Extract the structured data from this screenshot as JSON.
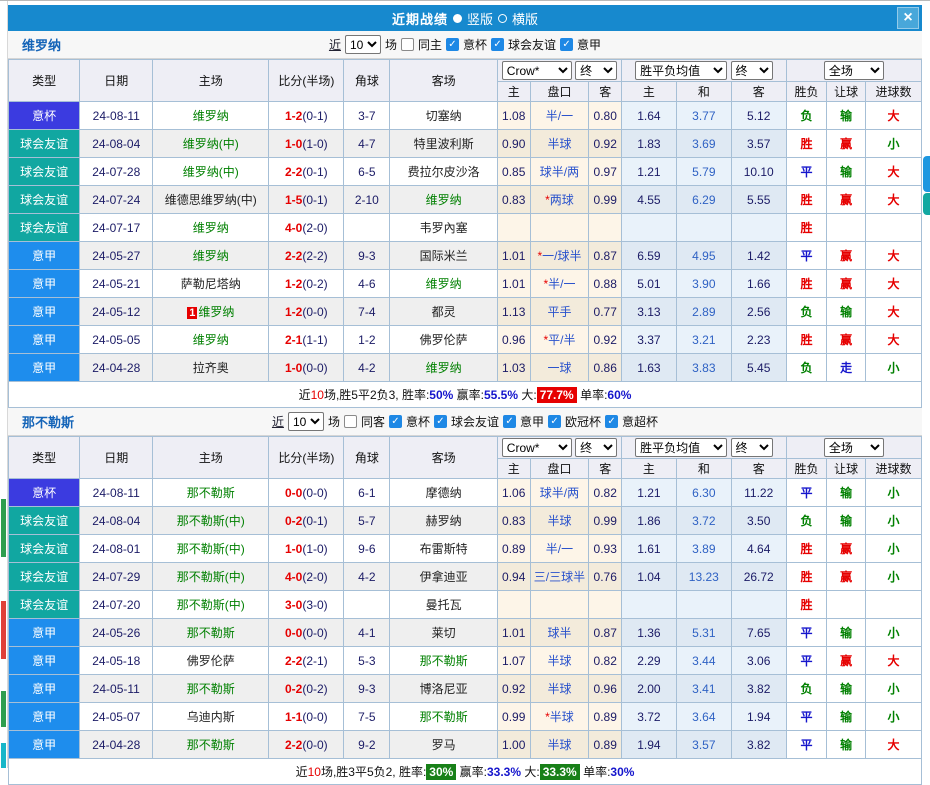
{
  "title_bar": {
    "title": "近期战绩",
    "radio_vertical": "竖版",
    "radio_horizontal": "横版",
    "close": "×"
  },
  "columns": {
    "type": "类型",
    "date": "日期",
    "home": "主场",
    "score": "比分(半场)",
    "corner": "角球",
    "away": "客场",
    "crow_select": "Crow*",
    "end_select": "终",
    "avg_select": "胜平负均值",
    "end_select2": "终",
    "full_select": "全场",
    "asia_home": "主",
    "asia_handicap": "盘口",
    "asia_away": "客",
    "eu_home": "主",
    "eu_draw": "和",
    "eu_away": "客",
    "result": "胜负",
    "handicap_result": "让球",
    "goals": "进球数"
  },
  "type_styles": {
    "意杯": "#3b3be0",
    "球会友谊": "#11a7a1",
    "意甲": "#1e8ded"
  },
  "sections": [
    {
      "team": "维罗纳",
      "filter": {
        "near": "近",
        "count": "10",
        "games": "场",
        "same_label": "同主",
        "same_checked": false,
        "leagues": [
          "意杯",
          "球会友谊",
          "意甲"
        ]
      },
      "rows": [
        {
          "type": "意杯",
          "date": "24-08-11",
          "home": "维罗纳",
          "home_c": "green",
          "score": "1-2",
          "half": "(0-1)",
          "corner": "3-7",
          "away": "切塞纳",
          "away_c": "dark",
          "ah": "1.08",
          "star": "",
          "hcap": "半/一",
          "aa": "0.80",
          "eh": "1.64",
          "ed": "3.77",
          "ea": "5.12",
          "res": "负",
          "res_c": "green",
          "hr": "输",
          "hr_c": "green",
          "gl": "大",
          "gl_c": "red"
        },
        {
          "type": "球会友谊",
          "date": "24-08-04",
          "home": "维罗纳(中)",
          "home_c": "green",
          "score": "1-0",
          "half": "(1-0)",
          "corner": "4-7",
          "away": "特里波利斯",
          "away_c": "dark",
          "ah": "0.90",
          "star": "",
          "hcap": "半球",
          "aa": "0.92",
          "eh": "1.83",
          "ed": "3.69",
          "ea": "3.57",
          "res": "胜",
          "res_c": "red",
          "hr": "赢",
          "hr_c": "red",
          "gl": "小",
          "gl_c": "green"
        },
        {
          "type": "球会友谊",
          "date": "24-07-28",
          "home": "维罗纳(中)",
          "home_c": "green",
          "score": "2-2",
          "half": "(0-1)",
          "corner": "6-5",
          "away": "费拉尔皮沙洛",
          "away_c": "dark",
          "ah": "0.85",
          "star": "",
          "hcap": "球半/两",
          "aa": "0.97",
          "eh": "1.21",
          "ed": "5.79",
          "ea": "10.10",
          "res": "平",
          "res_c": "blue",
          "hr": "输",
          "hr_c": "green",
          "gl": "大",
          "gl_c": "red"
        },
        {
          "type": "球会友谊",
          "date": "24-07-24",
          "home": "维德思维罗纳(中)",
          "home_c": "dark",
          "score": "1-5",
          "half": "(0-1)",
          "corner": "2-10",
          "away": "维罗纳",
          "away_c": "green",
          "ah": "0.83",
          "star": "*",
          "hcap": "两球",
          "aa": "0.99",
          "eh": "4.55",
          "ed": "6.29",
          "ea": "5.55",
          "res": "胜",
          "res_c": "red",
          "hr": "赢",
          "hr_c": "red",
          "gl": "大",
          "gl_c": "red"
        },
        {
          "type": "球会友谊",
          "date": "24-07-17",
          "home": "维罗纳",
          "home_c": "green",
          "score": "4-0",
          "half": "(2-0)",
          "corner": "",
          "away": "韦罗內塞",
          "away_c": "dark",
          "ah": "",
          "star": "",
          "hcap": "",
          "aa": "",
          "eh": "",
          "ed": "",
          "ea": "",
          "res": "胜",
          "res_c": "red",
          "hr": "",
          "hr_c": "",
          "gl": "",
          "gl_c": ""
        },
        {
          "type": "意甲",
          "date": "24-05-27",
          "home": "维罗纳",
          "home_c": "green",
          "score": "2-2",
          "half": "(2-2)",
          "corner": "9-3",
          "away": "国际米兰",
          "away_c": "dark",
          "ah": "1.01",
          "star": "*",
          "hcap": "一/球半",
          "aa": "0.87",
          "eh": "6.59",
          "ed": "4.95",
          "ea": "1.42",
          "res": "平",
          "res_c": "blue",
          "hr": "赢",
          "hr_c": "red",
          "gl": "大",
          "gl_c": "red"
        },
        {
          "type": "意甲",
          "date": "24-05-21",
          "home": "萨勒尼塔纳",
          "home_c": "dark",
          "score": "1-2",
          "half": "(0-2)",
          "corner": "4-6",
          "away": "维罗纳",
          "away_c": "green",
          "ah": "1.01",
          "star": "*",
          "hcap": "半/一",
          "aa": "0.88",
          "eh": "5.01",
          "ed": "3.90",
          "ea": "1.66",
          "res": "胜",
          "res_c": "red",
          "hr": "赢",
          "hr_c": "red",
          "gl": "大",
          "gl_c": "red"
        },
        {
          "type": "意甲",
          "date": "24-05-12",
          "home": "维罗纳",
          "home_c": "green",
          "badge": "1",
          "score": "1-2",
          "half": "(0-0)",
          "corner": "7-4",
          "away": "都灵",
          "away_c": "dark",
          "ah": "1.13",
          "star": "",
          "hcap": "平手",
          "aa": "0.77",
          "eh": "3.13",
          "ed": "2.89",
          "ea": "2.56",
          "res": "负",
          "res_c": "green",
          "hr": "输",
          "hr_c": "green",
          "gl": "大",
          "gl_c": "red"
        },
        {
          "type": "意甲",
          "date": "24-05-05",
          "home": "维罗纳",
          "home_c": "green",
          "score": "2-1",
          "half": "(1-1)",
          "corner": "1-2",
          "away": "佛罗伦萨",
          "away_c": "dark",
          "ah": "0.96",
          "star": "*",
          "hcap": "平/半",
          "aa": "0.92",
          "eh": "3.37",
          "ed": "3.21",
          "ea": "2.23",
          "res": "胜",
          "res_c": "red",
          "hr": "赢",
          "hr_c": "red",
          "gl": "大",
          "gl_c": "red"
        },
        {
          "type": "意甲",
          "date": "24-04-28",
          "home": "拉齐奥",
          "home_c": "dark",
          "score": "1-0",
          "half": "(0-0)",
          "corner": "4-2",
          "away": "维罗纳",
          "away_c": "green",
          "ah": "1.03",
          "star": "",
          "hcap": "一球",
          "aa": "0.86",
          "eh": "1.63",
          "ed": "3.83",
          "ea": "5.45",
          "res": "负",
          "res_c": "green",
          "hr": "走",
          "hr_c": "blue",
          "gl": "小",
          "gl_c": "green"
        }
      ],
      "summary": [
        {
          "t": "近"
        },
        {
          "t": "10",
          "c": "red"
        },
        {
          "t": "场,胜5平2负3, 胜率:"
        },
        {
          "t": "50%",
          "c": "blue"
        },
        {
          "t": " 赢率:"
        },
        {
          "t": "55.5%",
          "c": "blue"
        },
        {
          "t": " 大:"
        },
        {
          "t": "77.7%",
          "c": "hl-red"
        },
        {
          "t": " 单率:"
        },
        {
          "t": "60%",
          "c": "blue"
        }
      ]
    },
    {
      "team": "那不勒斯",
      "filter": {
        "near": "近",
        "count": "10",
        "games": "场",
        "same_label": "同客",
        "same_checked": false,
        "leagues": [
          "意杯",
          "球会友谊",
          "意甲",
          "欧冠杯",
          "意超杯"
        ]
      },
      "rows": [
        {
          "type": "意杯",
          "date": "24-08-11",
          "home": "那不勒斯",
          "home_c": "green",
          "score": "0-0",
          "half": "(0-0)",
          "corner": "6-1",
          "away": "摩德纳",
          "away_c": "dark",
          "ah": "1.06",
          "star": "",
          "hcap": "球半/两",
          "aa": "0.82",
          "eh": "1.21",
          "ed": "6.30",
          "ea": "11.22",
          "res": "平",
          "res_c": "blue",
          "hr": "输",
          "hr_c": "green",
          "gl": "小",
          "gl_c": "green"
        },
        {
          "type": "球会友谊",
          "date": "24-08-04",
          "home": "那不勒斯(中)",
          "home_c": "green",
          "score": "0-2",
          "half": "(0-1)",
          "corner": "5-7",
          "away": "赫罗纳",
          "away_c": "dark",
          "ah": "0.83",
          "star": "",
          "hcap": "半球",
          "aa": "0.99",
          "eh": "1.86",
          "ed": "3.72",
          "ea": "3.50",
          "res": "负",
          "res_c": "green",
          "hr": "输",
          "hr_c": "green",
          "gl": "小",
          "gl_c": "green"
        },
        {
          "type": "球会友谊",
          "date": "24-08-01",
          "home": "那不勒斯(中)",
          "home_c": "green",
          "score": "1-0",
          "half": "(1-0)",
          "corner": "9-6",
          "away": "布雷斯特",
          "away_c": "dark",
          "ah": "0.89",
          "star": "",
          "hcap": "半/一",
          "aa": "0.93",
          "eh": "1.61",
          "ed": "3.89",
          "ea": "4.64",
          "res": "胜",
          "res_c": "red",
          "hr": "赢",
          "hr_c": "red",
          "gl": "小",
          "gl_c": "green"
        },
        {
          "type": "球会友谊",
          "date": "24-07-29",
          "home": "那不勒斯(中)",
          "home_c": "green",
          "score": "4-0",
          "half": "(2-0)",
          "corner": "4-2",
          "away": "伊拿迪亚",
          "away_c": "dark",
          "ah": "0.94",
          "star": "",
          "hcap": "三/三球半",
          "aa": "0.76",
          "eh": "1.04",
          "ed": "13.23",
          "ea": "26.72",
          "res": "胜",
          "res_c": "red",
          "hr": "赢",
          "hr_c": "red",
          "gl": "小",
          "gl_c": "green"
        },
        {
          "type": "球会友谊",
          "date": "24-07-20",
          "home": "那不勒斯(中)",
          "home_c": "green",
          "score": "3-0",
          "half": "(3-0)",
          "corner": "",
          "away": "曼托瓦",
          "away_c": "dark",
          "ah": "",
          "star": "",
          "hcap": "",
          "aa": "",
          "eh": "",
          "ed": "",
          "ea": "",
          "res": "胜",
          "res_c": "red",
          "hr": "",
          "hr_c": "",
          "gl": "",
          "gl_c": ""
        },
        {
          "type": "意甲",
          "date": "24-05-26",
          "home": "那不勒斯",
          "home_c": "green",
          "score": "0-0",
          "half": "(0-0)",
          "corner": "4-1",
          "away": "莱切",
          "away_c": "dark",
          "ah": "1.01",
          "star": "",
          "hcap": "球半",
          "aa": "0.87",
          "eh": "1.36",
          "ed": "5.31",
          "ea": "7.65",
          "res": "平",
          "res_c": "blue",
          "hr": "输",
          "hr_c": "green",
          "gl": "小",
          "gl_c": "green"
        },
        {
          "type": "意甲",
          "date": "24-05-18",
          "home": "佛罗伦萨",
          "home_c": "dark",
          "score": "2-2",
          "half": "(2-1)",
          "corner": "5-3",
          "away": "那不勒斯",
          "away_c": "green",
          "ah": "1.07",
          "star": "",
          "hcap": "半球",
          "aa": "0.82",
          "eh": "2.29",
          "ed": "3.44",
          "ea": "3.06",
          "res": "平",
          "res_c": "blue",
          "hr": "赢",
          "hr_c": "red",
          "gl": "大",
          "gl_c": "red"
        },
        {
          "type": "意甲",
          "date": "24-05-11",
          "home": "那不勒斯",
          "home_c": "green",
          "score": "0-2",
          "half": "(0-2)",
          "corner": "9-3",
          "away": "博洛尼亚",
          "away_c": "dark",
          "ah": "0.92",
          "star": "",
          "hcap": "半球",
          "aa": "0.96",
          "eh": "2.00",
          "ed": "3.41",
          "ea": "3.82",
          "res": "负",
          "res_c": "green",
          "hr": "输",
          "hr_c": "green",
          "gl": "小",
          "gl_c": "green"
        },
        {
          "type": "意甲",
          "date": "24-05-07",
          "home": "乌迪内斯",
          "home_c": "dark",
          "score": "1-1",
          "half": "(0-0)",
          "corner": "7-5",
          "away": "那不勒斯",
          "away_c": "green",
          "ah": "0.99",
          "star": "*",
          "hcap": "半球",
          "aa": "0.89",
          "eh": "3.72",
          "ed": "3.64",
          "ea": "1.94",
          "res": "平",
          "res_c": "blue",
          "hr": "输",
          "hr_c": "green",
          "gl": "小",
          "gl_c": "green"
        },
        {
          "type": "意甲",
          "date": "24-04-28",
          "home": "那不勒斯",
          "home_c": "green",
          "score": "2-2",
          "half": "(0-0)",
          "corner": "9-2",
          "away": "罗马",
          "away_c": "dark",
          "ah": "1.00",
          "star": "",
          "hcap": "半球",
          "aa": "0.89",
          "eh": "1.94",
          "ed": "3.57",
          "ea": "3.82",
          "res": "平",
          "res_c": "blue",
          "hr": "输",
          "hr_c": "green",
          "gl": "大",
          "gl_c": "red"
        }
      ],
      "summary": [
        {
          "t": "近"
        },
        {
          "t": "10",
          "c": "red"
        },
        {
          "t": "场,胜3平5负2, 胜率:"
        },
        {
          "t": "30%",
          "c": "hl-green"
        },
        {
          "t": " 赢率:"
        },
        {
          "t": "33.3%",
          "c": "blue"
        },
        {
          "t": " 大:"
        },
        {
          "t": "33.3%",
          "c": "hl-green"
        },
        {
          "t": " 单率:"
        },
        {
          "t": "30%",
          "c": "blue"
        }
      ]
    }
  ]
}
